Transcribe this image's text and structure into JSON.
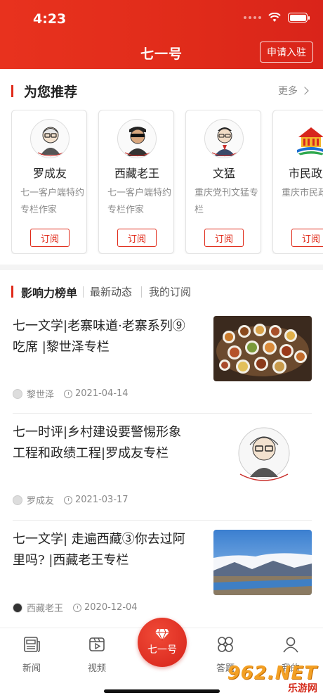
{
  "status_bar": {
    "time": "4:23"
  },
  "header": {
    "title": "七一号",
    "apply_label": "申请入驻"
  },
  "recommend": {
    "title": "为您推荐",
    "more_label": "更多",
    "cards": [
      {
        "name": "罗成友",
        "desc": "七一客户端特约专栏作家",
        "subscribe": "订阅",
        "avatar": "cartoon-portrait-glasses"
      },
      {
        "name": "西藏老王",
        "desc": "七一客户端特约专栏作家",
        "subscribe": "订阅",
        "avatar": "cartoon-portrait-sunglasses"
      },
      {
        "name": "文猛",
        "desc": "重庆党刊文猛专栏",
        "subscribe": "订阅",
        "avatar": "cartoon-portrait-suit"
      },
      {
        "name": "市民政府",
        "desc": "重庆市民政府",
        "subscribe": "订阅",
        "avatar": "government-logo"
      }
    ]
  },
  "tabs": [
    {
      "label": "影响力榜单",
      "active": true
    },
    {
      "label": "最新动态",
      "active": false
    },
    {
      "label": "我的订阅",
      "active": false
    }
  ],
  "articles": [
    {
      "title": "七一文学|老寨味道·老寨系列⑨吃席 |黎世泽专栏",
      "author": "黎世泽",
      "date": "2021-04-14",
      "thumb": "banquet-food-photo"
    },
    {
      "title": "七一时评|乡村建设要警惕形象工程和政绩工程|罗成友专栏",
      "author": "罗成友",
      "date": "2021-03-17",
      "thumb": "cartoon-portrait"
    },
    {
      "title": "七一文学| 走遍西藏③你去过阿里吗? |西藏老王专栏",
      "author": "西藏老王",
      "date": "2020-12-04",
      "thumb": "tibet-landscape-photo"
    }
  ],
  "bottom_nav": [
    {
      "label": "新闻",
      "icon": "newspaper-icon"
    },
    {
      "label": "视频",
      "icon": "video-icon"
    },
    {
      "label": "七一号",
      "icon": "gem-icon"
    },
    {
      "label": "答题",
      "icon": "quiz-icon"
    },
    {
      "label": "我的",
      "icon": "user-icon"
    }
  ],
  "watermark": {
    "num": "962.NET",
    "sub": "乐游网"
  },
  "colors": {
    "brand_red": "#e02b1a",
    "text": "#222222",
    "muted": "#888888"
  }
}
